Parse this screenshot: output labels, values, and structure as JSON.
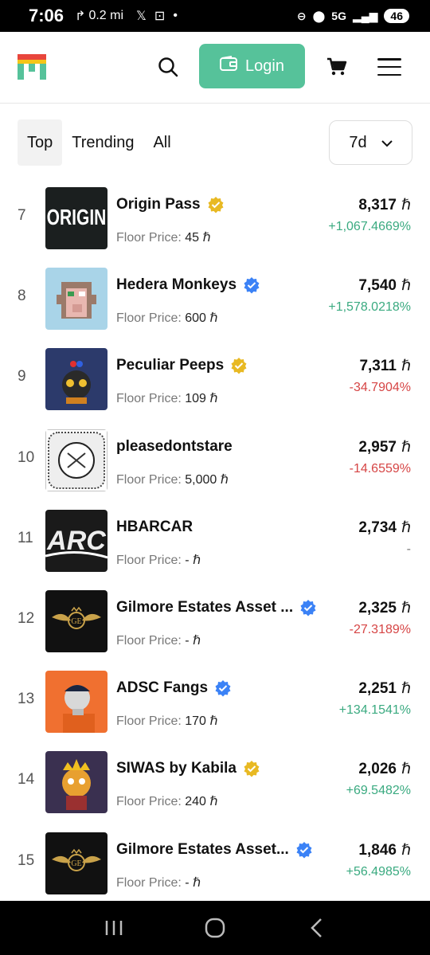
{
  "status": {
    "time": "7:06",
    "distance": "0.2 mi",
    "network": "5G",
    "battery": "46"
  },
  "header": {
    "login_label": "Login"
  },
  "tabs": [
    {
      "label": "Top",
      "active": true
    },
    {
      "label": "Trending",
      "active": false
    },
    {
      "label": "All",
      "active": false
    }
  ],
  "period": {
    "selected": "7d"
  },
  "floor_label": "Floor Price:",
  "currency": "ℏ",
  "collections": [
    {
      "rank": "7",
      "name": "Origin Pass",
      "badge": "gold",
      "floor": "45",
      "volume": "8,317",
      "change": "+1,067.4669%",
      "trend": "up",
      "thumb": "origin"
    },
    {
      "rank": "8",
      "name": "Hedera Monkeys",
      "badge": "blue",
      "floor": "600",
      "volume": "7,540",
      "change": "+1,578.0218%",
      "trend": "up",
      "thumb": "monkey"
    },
    {
      "rank": "9",
      "name": "Peculiar Peeps",
      "badge": "gold",
      "floor": "109",
      "volume": "7,311",
      "change": "-34.7904%",
      "trend": "down",
      "thumb": "peeps"
    },
    {
      "rank": "10",
      "name": "pleasedontstare",
      "badge": "",
      "floor": "5,000",
      "volume": "2,957",
      "change": "-14.6559%",
      "trend": "down",
      "thumb": "stare"
    },
    {
      "rank": "11",
      "name": "HBARCAR",
      "badge": "",
      "floor": "-",
      "volume": "2,734",
      "change": "-",
      "trend": "flat",
      "thumb": "hbarcar"
    },
    {
      "rank": "12",
      "name": "Gilmore Estates Asset ...",
      "badge": "blue",
      "floor": "-",
      "volume": "2,325",
      "change": "-27.3189%",
      "trend": "down",
      "thumb": "gilmore"
    },
    {
      "rank": "13",
      "name": "ADSC Fangs",
      "badge": "blue",
      "floor": "170",
      "volume": "2,251",
      "change": "+134.1541%",
      "trend": "up",
      "thumb": "fangs"
    },
    {
      "rank": "14",
      "name": "SIWAS by Kabila",
      "badge": "gold",
      "floor": "240",
      "volume": "2,026",
      "change": "+69.5482%",
      "trend": "up",
      "thumb": "siwas"
    },
    {
      "rank": "15",
      "name": "Gilmore Estates Asset...",
      "badge": "blue",
      "floor": "-",
      "volume": "1,846",
      "change": "+56.4985%",
      "trend": "up",
      "thumb": "gilmore"
    }
  ],
  "colors": {
    "accent": "#56c29a",
    "up": "#3aaa80",
    "down": "#d64545",
    "badge_gold": "#e8b923",
    "badge_blue": "#3b82f6"
  }
}
